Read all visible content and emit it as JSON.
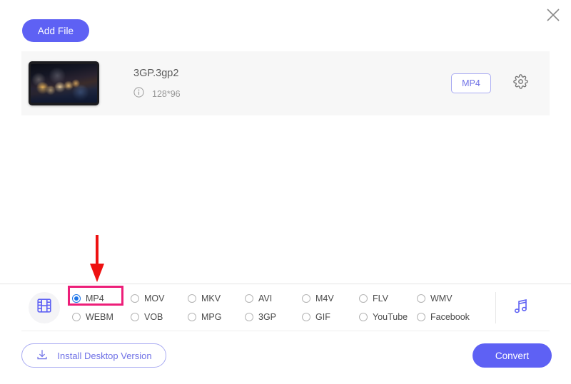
{
  "window": {
    "close_icon": "close-icon"
  },
  "toolbar": {
    "add_file_label": "Add File"
  },
  "file": {
    "name": "3GP.3gp2",
    "resolution": "128*96",
    "info_icon": "info-icon",
    "thumbnail_icon": "video-thumbnail",
    "target_format_label": "MP4",
    "settings_icon": "gear-icon"
  },
  "formats": {
    "media_icon": "film-strip-icon",
    "audio_icon": "music-note-icon",
    "selected": "MP4",
    "items": [
      {
        "label": "MP4",
        "selected": true
      },
      {
        "label": "MOV",
        "selected": false
      },
      {
        "label": "MKV",
        "selected": false
      },
      {
        "label": "AVI",
        "selected": false
      },
      {
        "label": "M4V",
        "selected": false
      },
      {
        "label": "FLV",
        "selected": false
      },
      {
        "label": "WMV",
        "selected": false
      },
      {
        "label": "WEBM",
        "selected": false
      },
      {
        "label": "VOB",
        "selected": false
      },
      {
        "label": "MPG",
        "selected": false
      },
      {
        "label": "3GP",
        "selected": false
      },
      {
        "label": "GIF",
        "selected": false
      },
      {
        "label": "YouTube",
        "selected": false
      },
      {
        "label": "Facebook",
        "selected": false
      }
    ]
  },
  "footer": {
    "install_label": "Install Desktop Version",
    "install_icon": "download-icon",
    "convert_label": "Convert"
  },
  "annotations": {
    "highlight_color": "#ed1e79",
    "arrow_color": "#ee1111",
    "highlight_target": "MP4"
  },
  "colors": {
    "accent": "#5e61f4",
    "accent_light": "#a9abf2",
    "radio_selected": "#1a73e8",
    "card_bg": "#f7f7f7"
  }
}
